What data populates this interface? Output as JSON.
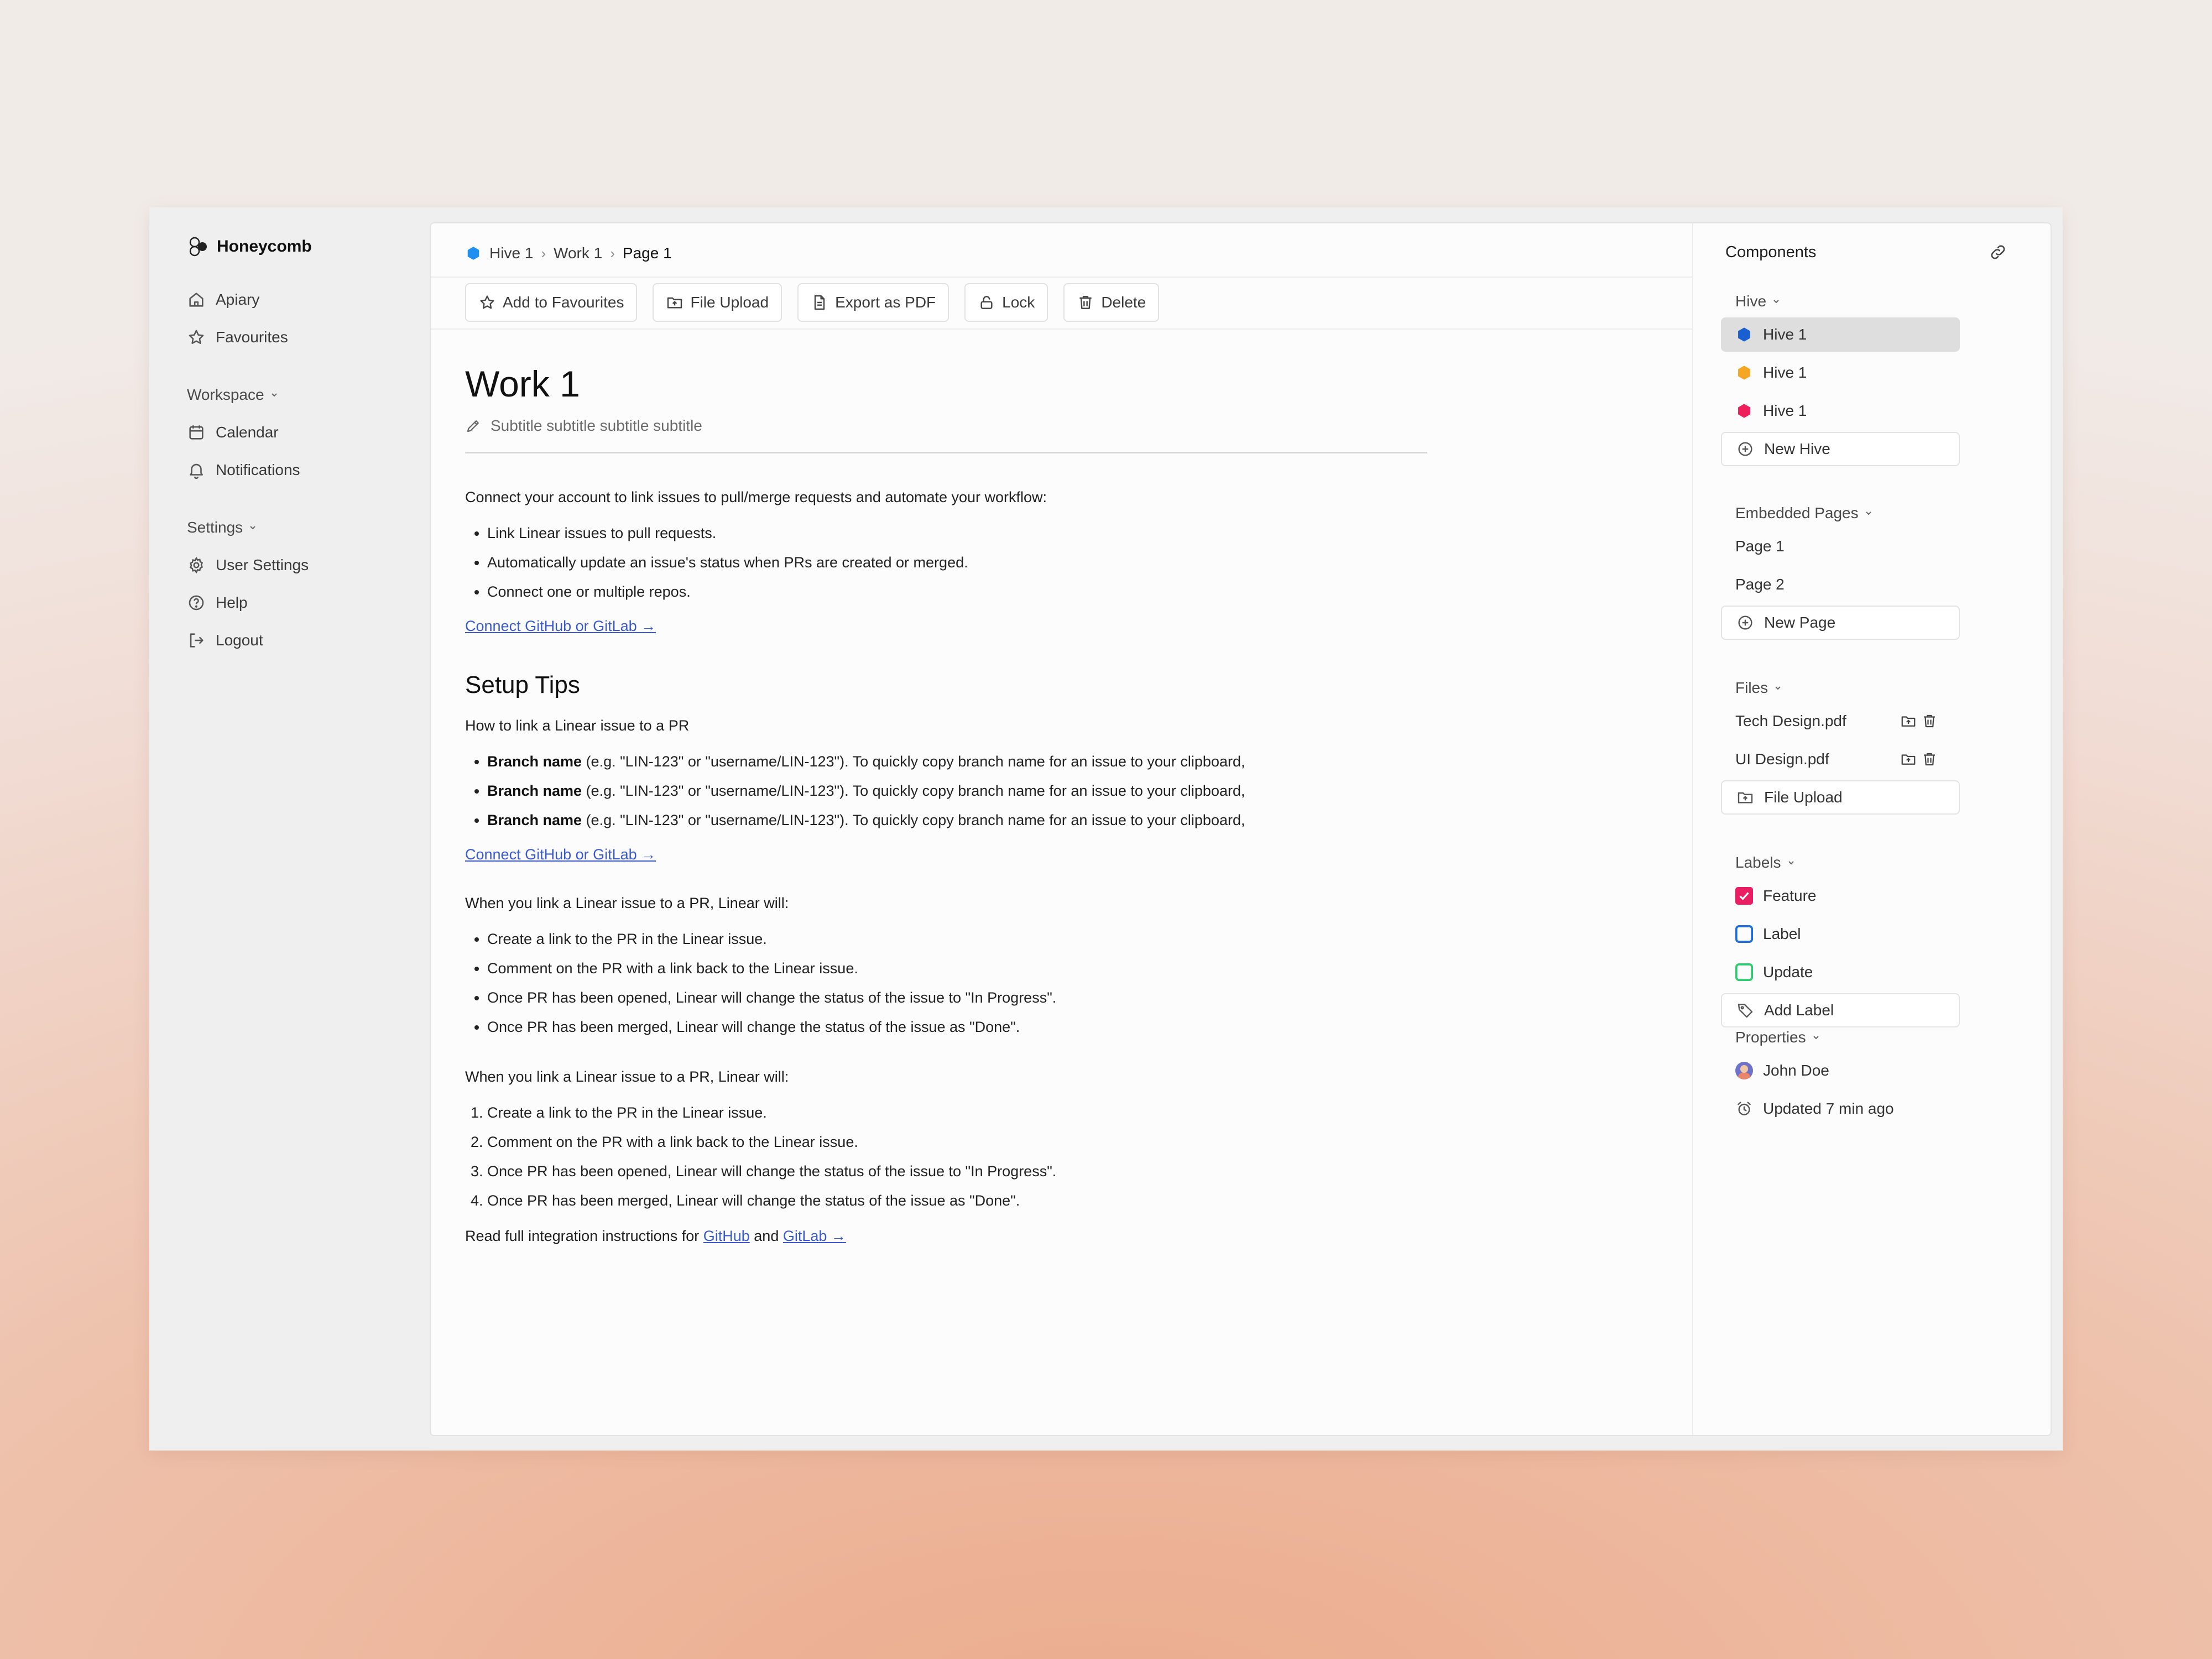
{
  "app": {
    "name": "Honeycomb"
  },
  "sidebar": {
    "top_items": [
      {
        "label": "Apiary",
        "icon": "home-icon"
      },
      {
        "label": "Favourites",
        "icon": "star-icon"
      }
    ],
    "workspace": {
      "label": "Workspace",
      "items": [
        {
          "label": "Calendar",
          "icon": "calendar-icon"
        },
        {
          "label": "Notifications",
          "icon": "bell-icon"
        }
      ]
    },
    "settings": {
      "label": "Settings",
      "items": [
        {
          "label": "User Settings",
          "icon": "gear-icon"
        },
        {
          "label": "Help",
          "icon": "help-icon"
        },
        {
          "label": "Logout",
          "icon": "logout-icon"
        }
      ]
    }
  },
  "breadcrumb": {
    "items": [
      "Hive 1",
      "Work 1",
      "Page 1"
    ],
    "separator": "›",
    "hive_color": "#1e90f0"
  },
  "toolbar": {
    "favourites": "Add to Favourites",
    "upload": "File Upload",
    "export": "Export as PDF",
    "lock": "Lock",
    "delete": "Delete"
  },
  "document": {
    "title": "Work 1",
    "subtitle": "Subtitle subtitle subtitle subtitle",
    "intro": "Connect your account to link issues to pull/merge requests and automate your workflow:",
    "intro_bullets": [
      "Link Linear issues to pull requests.",
      "Automatically update an issue's status when PRs are created or merged.",
      "Connect one or multiple repos."
    ],
    "link_label": "Connect GitHub or GitLab →",
    "setup_heading": "Setup Tips",
    "howto": "How to link a Linear issue to a PR",
    "branch_bullets": [
      {
        "bold": "Branch name",
        "rest": " (e.g. \"LIN-123\" or \"username/LIN-123\"). To quickly copy branch name for an issue to your clipboard,"
      },
      {
        "bold": "Branch name",
        "rest": " (e.g. \"LIN-123\" or \"username/LIN-123\"). To quickly copy branch name for an issue to your clipboard,"
      },
      {
        "bold": "Branch name",
        "rest": " (e.g. \"LIN-123\" or \"username/LIN-123\"). To quickly copy branch name for an issue to your clipboard,"
      }
    ],
    "when_heading": "When you link a Linear issue to a PR, Linear will:",
    "when_bullets": [
      "Create a link to the PR in the Linear issue.",
      "Comment on the PR with a link back to the Linear issue.",
      "Once PR has been opened, Linear will change the status of the issue to \"In Progress\".",
      "Once PR has been merged, Linear will change the status of the issue as \"Done\"."
    ],
    "footer": {
      "prefix": "Read full integration instructions for ",
      "github": "GitHub",
      "and": " and ",
      "gitlab": "GitLab →"
    }
  },
  "components": {
    "title": "Components",
    "hive": {
      "label": "Hive",
      "items": [
        {
          "label": "Hive 1",
          "color": "#1a5fd0",
          "active": true
        },
        {
          "label": "Hive 1",
          "color": "#f5a623",
          "active": false
        },
        {
          "label": "Hive 1",
          "color": "#ee1f5a",
          "active": false
        }
      ],
      "new_label": "New Hive"
    },
    "pages": {
      "label": "Embedded Pages",
      "items": [
        "Page 1",
        "Page 2"
      ],
      "new_label": "New Page"
    },
    "files": {
      "label": "Files",
      "items": [
        "Tech Design.pdf",
        "UI Design.pdf"
      ],
      "upload_label": "File Upload"
    },
    "labels": {
      "label": "Labels",
      "items": [
        {
          "label": "Feature",
          "color": "#e91e63",
          "checked": true
        },
        {
          "label": "Label",
          "color": "#1e6fd9",
          "checked": false
        },
        {
          "label": "Update",
          "color": "#2ecc71",
          "checked": false
        }
      ],
      "add_label": "Add Label"
    },
    "properties": {
      "label": "Properties",
      "owner": "John Doe",
      "updated": "Updated 7 min ago"
    }
  }
}
